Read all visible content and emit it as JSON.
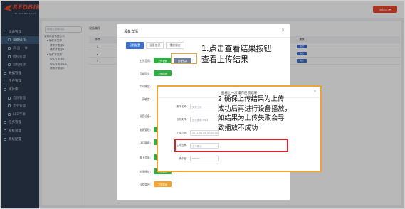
{
  "app": {
    "logo_text": "REDBIRD",
    "logo_sub": "FM SOUND CAST",
    "user_button": "admin ▾"
  },
  "sidebar": {
    "items": [
      {
        "label": "设备管理",
        "level": 0,
        "active": false
      },
      {
        "label": "设备操作",
        "level": 1,
        "active": true
      },
      {
        "label": "声·画·一体",
        "level": 1,
        "active": false
      },
      {
        "label": "授权管理",
        "level": 1,
        "active": false
      },
      {
        "label": "远程播放",
        "level": 1,
        "active": false
      },
      {
        "label": "数据管理",
        "level": 0,
        "active": false
      },
      {
        "label": "用户管理",
        "level": 0,
        "active": false
      },
      {
        "label": "媒体库",
        "level": 0,
        "active": false
      },
      {
        "label": "音频管理",
        "level": 1,
        "active": false
      },
      {
        "label": "文字管理",
        "level": 1,
        "active": false
      },
      {
        "label": "LED字幕",
        "level": 1,
        "active": false
      },
      {
        "label": "任务管理",
        "level": 0,
        "active": false
      },
      {
        "label": "系统管理",
        "level": 0,
        "active": false
      },
      {
        "label": "系统配置",
        "level": 0,
        "active": false
      }
    ]
  },
  "tree": {
    "search_placeholder": "请输入搜索内容",
    "items": [
      {
        "label": "某某科技有限公司",
        "indent": 0
      },
      {
        "label": "▾ 硬件开发部",
        "indent": 1
      },
      {
        "label": "硬件开发部1",
        "indent": 2
      },
      {
        "label": "硬件开发部2",
        "indent": 2
      },
      {
        "label": "▾ 软件开发部",
        "indent": 1
      },
      {
        "label": "软件开发部1",
        "indent": 2
      },
      {
        "label": "软件开发部1-2",
        "indent": 2
      },
      {
        "label": "硬件开发部3",
        "indent": 2
      }
    ]
  },
  "toolbar": {
    "label": "设备编号"
  },
  "table": {
    "headers": [
      "序号",
      "设备名称",
      "设备编号",
      "在线状态",
      "当前音量",
      "操作"
    ],
    "rows": [
      {
        "idx": "1",
        "name": "",
        "id": "",
        "status": "在线",
        "volume": "",
        "action": "操作"
      },
      {
        "idx": "2",
        "name": "",
        "id": "",
        "status": "在线",
        "volume": "",
        "action": "操作"
      },
      {
        "idx": "3",
        "name": "",
        "id": "",
        "status": "在线",
        "volume": "",
        "action": "操作"
      }
    ]
  },
  "device_dialog": {
    "title": "设备详情",
    "close": "×",
    "tabs": [
      "远程配置",
      "设备信息",
      "播放状态"
    ],
    "rows": [
      {
        "label": "上传音频:",
        "button": "上传音频",
        "extra": "查看结果"
      },
      {
        "label": "音量同步:",
        "button": "立即同步"
      },
      {
        "label": "实时播放:",
        "button": ""
      },
      {
        "label": "灵敏度:",
        "button": ""
      },
      {
        "label": "录音设备:",
        "button": ""
      },
      {
        "label": "电源管理:",
        "button": "立即操作"
      },
      {
        "label": "LED屏幕:",
        "button": "立即操作"
      },
      {
        "label": "摘下音量:",
        "button": "立即操作"
      },
      {
        "label": "关闭播放:",
        "button": "立即操作"
      },
      {
        "label": "远程重启:",
        "button": "立即重启"
      }
    ]
  },
  "result_dialog": {
    "title": "查看上一次操作反馈结果",
    "close": "×",
    "rows": [
      {
        "label": "操作名称:",
        "value": "文件上传"
      },
      {
        "label": "当前文件:",
        "value": "提示音频.mp3"
      },
      {
        "label": "上传时间:",
        "value": "2021-01-01 00:00:00"
      },
      {
        "label": "上传结果:",
        "value": "上传成功"
      },
      {
        "label": "操作者:",
        "value": "admin"
      }
    ]
  },
  "annotations": {
    "step1_line1": "1.点击查看结果按钮",
    "step1_line2": "查看上传结果",
    "step2_line1": "2.确保上传结果为上传",
    "step2_line2": "成功后再进行设备播放，",
    "step2_line3": "如结果为上传失败会导",
    "step2_line4": "致播放不成功"
  },
  "colors": {
    "brand_red": "#e8492f",
    "sidebar_bg": "#2b3a4d",
    "primary_blue": "#3d6fd0",
    "success_green": "#2fae43",
    "highlight_orange": "#f0a430",
    "highlight_red": "#d9232d"
  }
}
